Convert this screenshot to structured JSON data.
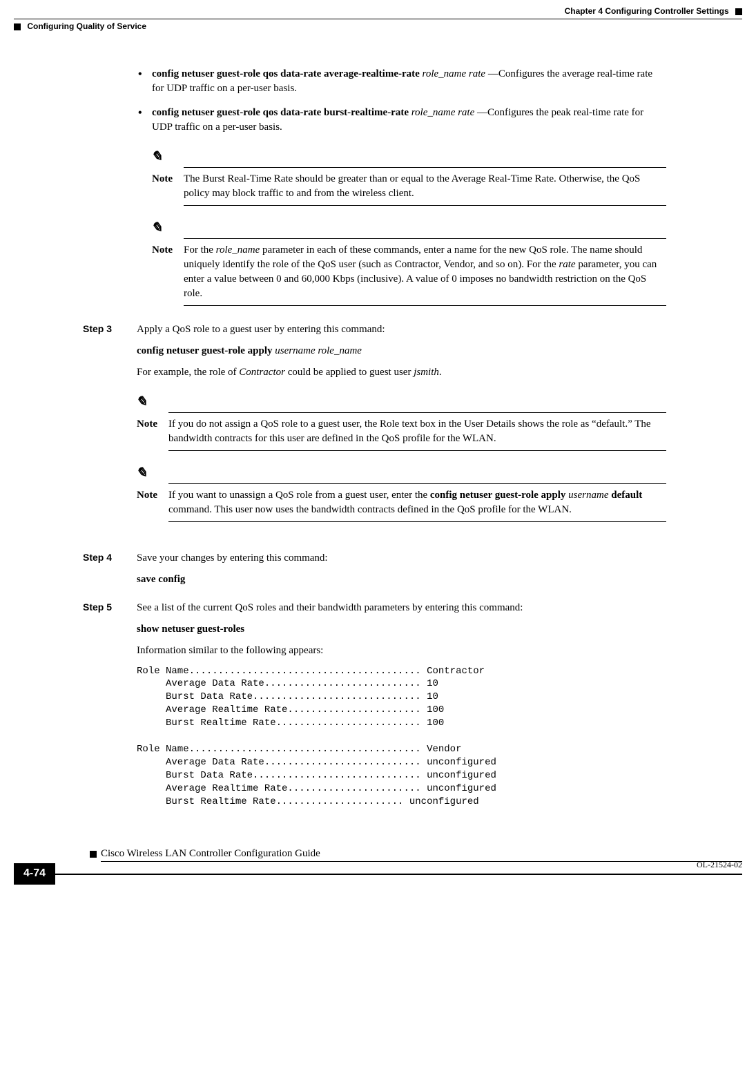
{
  "header": {
    "chapter": "Chapter 4      Configuring Controller Settings",
    "section": "Configuring Quality of Service"
  },
  "bullets": {
    "b1_cmd": "config netuser guest-role qos data-rate average-realtime-rate",
    "b1_args": "role_name rate",
    "b1_desc": "—Configures the average real-time rate for UDP traffic on a per-user basis.",
    "b2_cmd": "config netuser guest-role qos data-rate burst-realtime-rate",
    "b2_args": "role_name rate",
    "b2_desc": "—Configures the peak real-time rate for UDP traffic on a per-user basis."
  },
  "notes": {
    "n1": "The Burst Real-Time Rate should be greater than or equal to the Average Real-Time Rate. Otherwise, the QoS policy may block traffic to and from the wireless client.",
    "n2_a": "For the ",
    "n2_i1": "role_name",
    "n2_b": " parameter in each of these commands, enter a name for the new QoS role. The name should uniquely identify the role of the QoS user (such as Contractor, Vendor, and so on). For the ",
    "n2_i2": "rate",
    "n2_c": " parameter, you can enter a value between 0 and 60,000 Kbps (inclusive). A value of 0 imposes no bandwidth restriction on the QoS role.",
    "n3": "If you do not assign a QoS role to a guest user, the Role text box in the User Details shows the role as “default.” The bandwidth contracts for this user are defined in the QoS profile for the WLAN.",
    "n4_a": "If you want to unassign a QoS role from a guest user, enter the ",
    "n4_b": "config netuser guest-role apply ",
    "n4_i": "username",
    "n4_c": " default",
    "n4_d": " command. This user now uses the bandwidth contracts defined in the QoS profile for the WLAN."
  },
  "steps": {
    "s3_label": "Step 3",
    "s3_text": "Apply a QoS role to a guest user by entering this command:",
    "s3_cmd": "config netuser guest-role apply",
    "s3_args": "username role_name",
    "s3_eg_a": "For example, the role of ",
    "s3_eg_i1": "Contractor",
    "s3_eg_b": " could be applied to guest user ",
    "s3_eg_i2": "jsmith",
    "s3_eg_c": ".",
    "s4_label": "Step 4",
    "s4_text": "Save your changes by entering this command:",
    "s4_cmd": "save config",
    "s5_label": "Step 5",
    "s5_text": "See a list of the current QoS roles and their bandwidth parameters by entering this command:",
    "s5_cmd": "show netuser guest-roles",
    "s5_info": "Information similar to the following appears:"
  },
  "labels": {
    "note": "Note"
  },
  "code_output": "Role Name........................................ Contractor\n     Average Data Rate........................... 10\n     Burst Data Rate............................. 10\n     Average Realtime Rate....................... 100\n     Burst Realtime Rate......................... 100\n\nRole Name........................................ Vendor\n     Average Data Rate........................... unconfigured\n     Burst Data Rate............................. unconfigured\n     Average Realtime Rate....................... unconfigured\n     Burst Realtime Rate...................... unconfigured",
  "footer": {
    "book_title": "Cisco Wireless LAN Controller Configuration Guide",
    "page_number": "4-74",
    "doc_id": "OL-21524-02"
  }
}
